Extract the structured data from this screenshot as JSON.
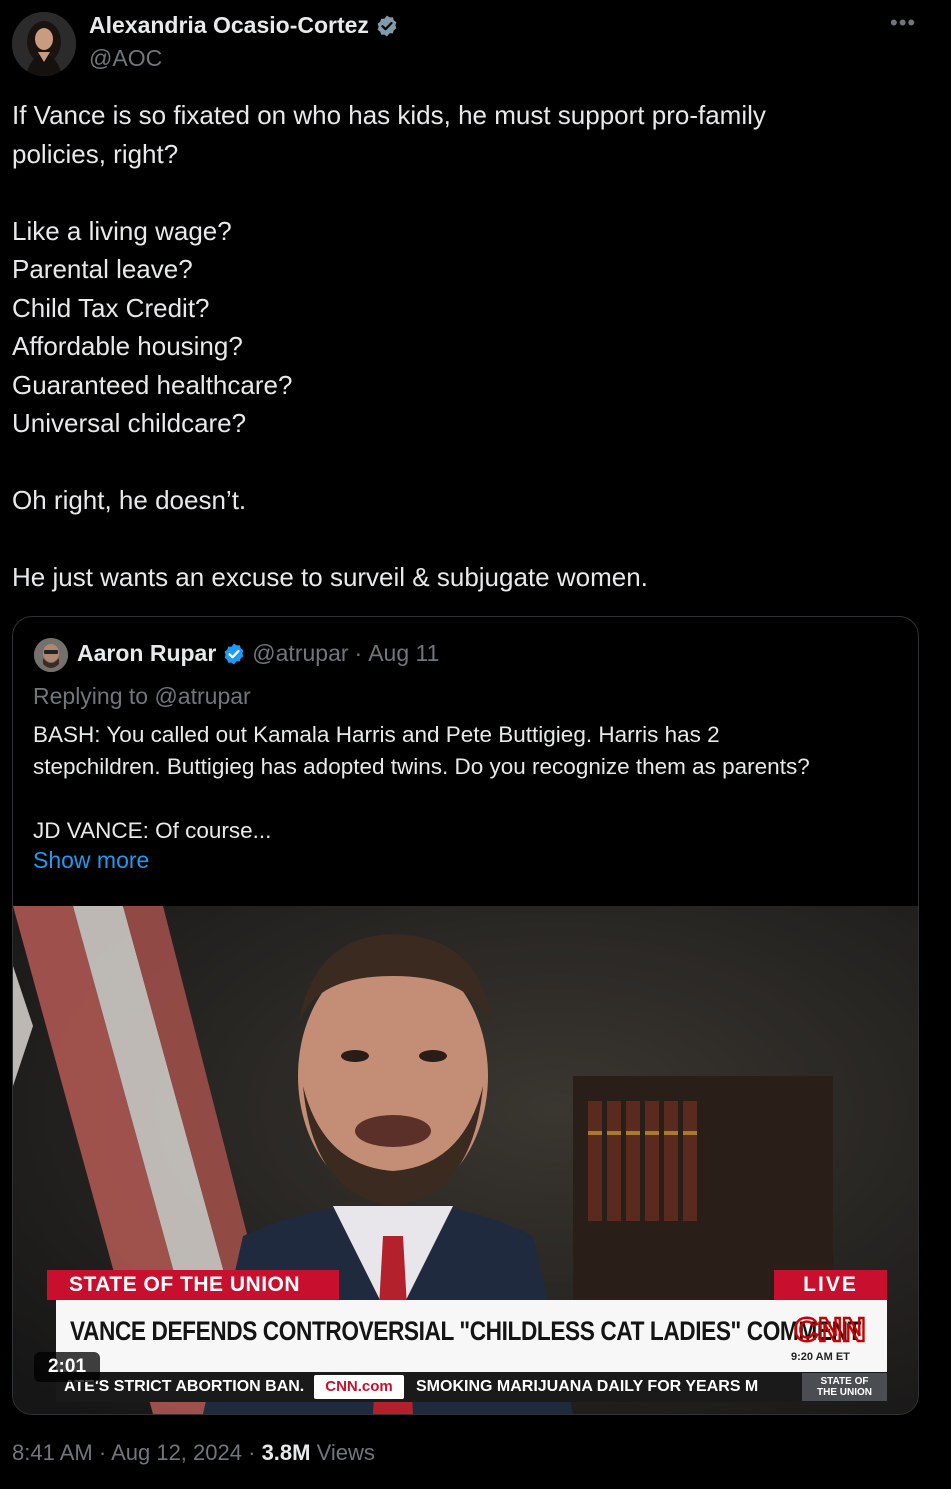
{
  "tweet": {
    "author_name": "Alexandria Ocasio-Cortez",
    "handle": "@AOC",
    "more_icon": "more-horizontal-icon",
    "verified_color": "#829aab",
    "lines": [
      "If Vance is so fixated on who has kids, he must support pro-family",
      "policies, right?",
      "",
      "Like a living wage?",
      "Parental leave?",
      "Child Tax Credit?",
      "Affordable housing?",
      "Guaranteed healthcare?",
      "Universal childcare?",
      "",
      "Oh right, he doesn’t.",
      "",
      "He just wants an excuse to surveil & subjugate women."
    ],
    "time": "8:41 AM",
    "date": "Aug 12, 2024",
    "views_count": "3.8M",
    "views_label": "Views"
  },
  "quote": {
    "author_name": "Aaron Rupar",
    "handle": "@atrupar",
    "date": "Aug 11",
    "verified_color": "#1d9bf0",
    "replying_to": "Replying to @atrupar",
    "lines": [
      "BASH: You called out Kamala Harris and Pete Buttigieg. Harris has 2",
      "stepchildren. Buttigieg has adopted twins. Do you recognize them as parents?",
      "",
      "JD VANCE: Of course..."
    ],
    "show_more": "Show more",
    "video": {
      "duration": "2:01",
      "show_tag": "STATE OF THE UNION",
      "live_tag": "LIVE",
      "headline": "VANCE DEFENDS CONTROVERSIAL \"CHILDLESS CAT LADIES\" COMMENT",
      "network": "CNN",
      "time_et": "9:20 AM ET",
      "ticker_left": "ATE'S STRICT ABORTION BAN.",
      "ticker_site": "CNN.com",
      "ticker_right": "SMOKING MARIJUANA DAILY FOR YEARS M",
      "ticker_show_line1": "STATE OF",
      "ticker_show_line2": "THE UNION"
    }
  }
}
